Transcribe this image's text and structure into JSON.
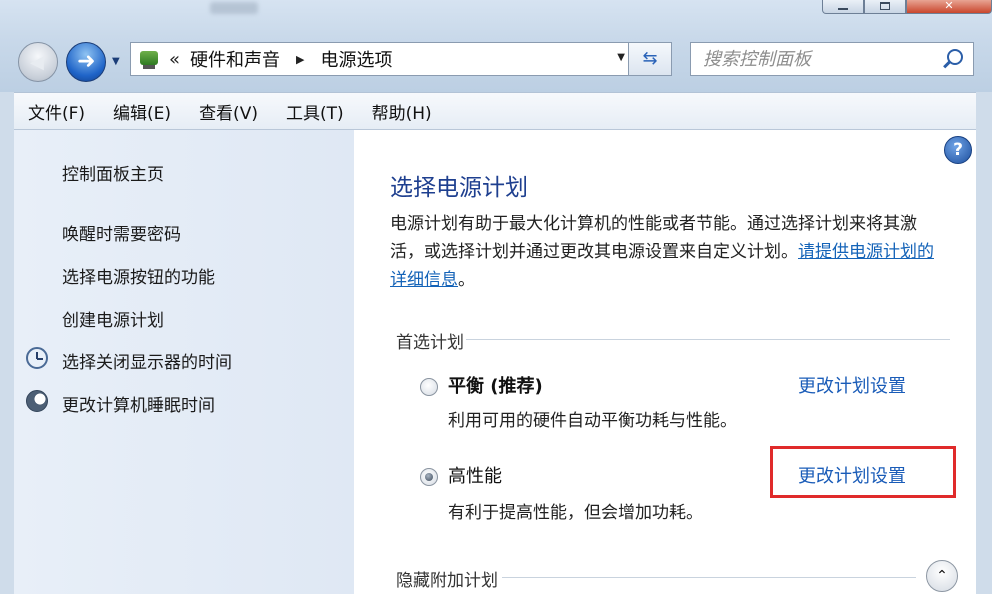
{
  "window": {
    "caption_close": "✕"
  },
  "nav": {
    "back_glyph": "◀",
    "forward_glyph": "➜",
    "history_glyph": "▼"
  },
  "address": {
    "separator": "«",
    "crumbs": [
      "硬件和声音",
      "电源选项"
    ],
    "crumb_arrow": "▶",
    "dropdown_glyph": "▼",
    "refresh_glyph": "⇆"
  },
  "search": {
    "placeholder": "搜索控制面板"
  },
  "menu": {
    "items": [
      "文件(F)",
      "编辑(E)",
      "查看(V)",
      "工具(T)",
      "帮助(H)"
    ]
  },
  "sidebar": {
    "home": "控制面板主页",
    "links": [
      {
        "label": "唤醒时需要密码",
        "icon": ""
      },
      {
        "label": "选择电源按钮的功能",
        "icon": ""
      },
      {
        "label": "创建电源计划",
        "icon": ""
      },
      {
        "label": "选择关闭显示器的时间",
        "icon": "clock-icon"
      },
      {
        "label": "更改计算机睡眠时间",
        "icon": "moon-icon"
      }
    ]
  },
  "help": {
    "glyph": "?"
  },
  "main": {
    "title": "选择电源计划",
    "description": "电源计划有助于最大化计算机的性能或者节能。通过选择计划来将其激活，或选择计划并通过更改其电源设置来自定义计划。",
    "description_link": "请提供电源计划的详细信息",
    "description_tail": "。",
    "preferred_header": "首选计划",
    "plans": [
      {
        "name": "平衡 (推荐)",
        "description": "利用可用的硬件自动平衡功耗与性能。",
        "selected": false,
        "change_label": "更改计划设置"
      },
      {
        "name": "高性能",
        "description": "有利于提高性能，但会增加功耗。",
        "selected": true,
        "change_label": "更改计划设置"
      }
    ],
    "hidden_header": "隐藏附加计划",
    "expand_glyph": "⌃"
  },
  "colors": {
    "link": "#1a5cb8",
    "title": "#1e3f8f",
    "highlight": "#e02a2a"
  }
}
